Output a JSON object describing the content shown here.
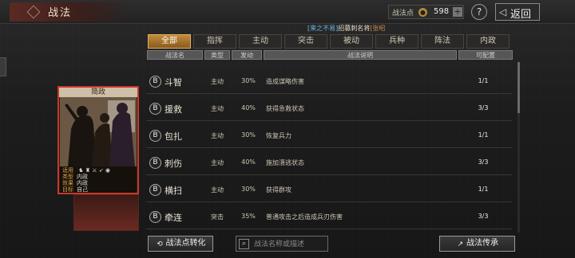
{
  "header": {
    "title": "战法",
    "points_label": "战法点",
    "points_value": "598",
    "plus": "+",
    "help": "?",
    "back_label": "返回"
  },
  "banner": {
    "part1": "[来之不易]",
    "part2": "招募刺名将",
    "part3": "[张昭"
  },
  "tabs": [
    "全部",
    "指挥",
    "主动",
    "突击",
    "被动",
    "兵种",
    "阵法",
    "内政"
  ],
  "active_tab": 0,
  "columns": [
    "战法名",
    "类型",
    "发动",
    "战法说明",
    "可配置"
  ],
  "rows": [
    {
      "badge": "B",
      "name": "斗智",
      "type": "主动",
      "rate": "30%",
      "desc": "造成谋略伤害",
      "count": "1/1"
    },
    {
      "badge": "B",
      "name": "援救",
      "type": "主动",
      "rate": "40%",
      "desc": "获得急救状态",
      "count": "3/3"
    },
    {
      "badge": "B",
      "name": "包扎",
      "type": "主动",
      "rate": "30%",
      "desc": "恢复兵力",
      "count": "1/1"
    },
    {
      "badge": "B",
      "name": "刺伤",
      "type": "主动",
      "rate": "40%",
      "desc": "施加溃逃状态",
      "count": "3/3"
    },
    {
      "badge": "B",
      "name": "横扫",
      "type": "主动",
      "rate": "30%",
      "desc": "获得群攻",
      "count": "1/1"
    },
    {
      "badge": "B",
      "name": "牵连",
      "type": "突击",
      "rate": "35%",
      "desc": "普通攻击之后造成兵刃伤害",
      "count": "3/3"
    }
  ],
  "card": {
    "title": "简政",
    "info": [
      {
        "k": "适用",
        "v": ""
      },
      {
        "k": "类型",
        "v": "内政"
      },
      {
        "k": "效果",
        "v": "内政"
      },
      {
        "k": "目标",
        "v": "自己"
      }
    ]
  },
  "bottom": {
    "convert_label": "战法点转化",
    "search_placeholder": "战法名称或描述",
    "inherit_label": "战法传承"
  }
}
